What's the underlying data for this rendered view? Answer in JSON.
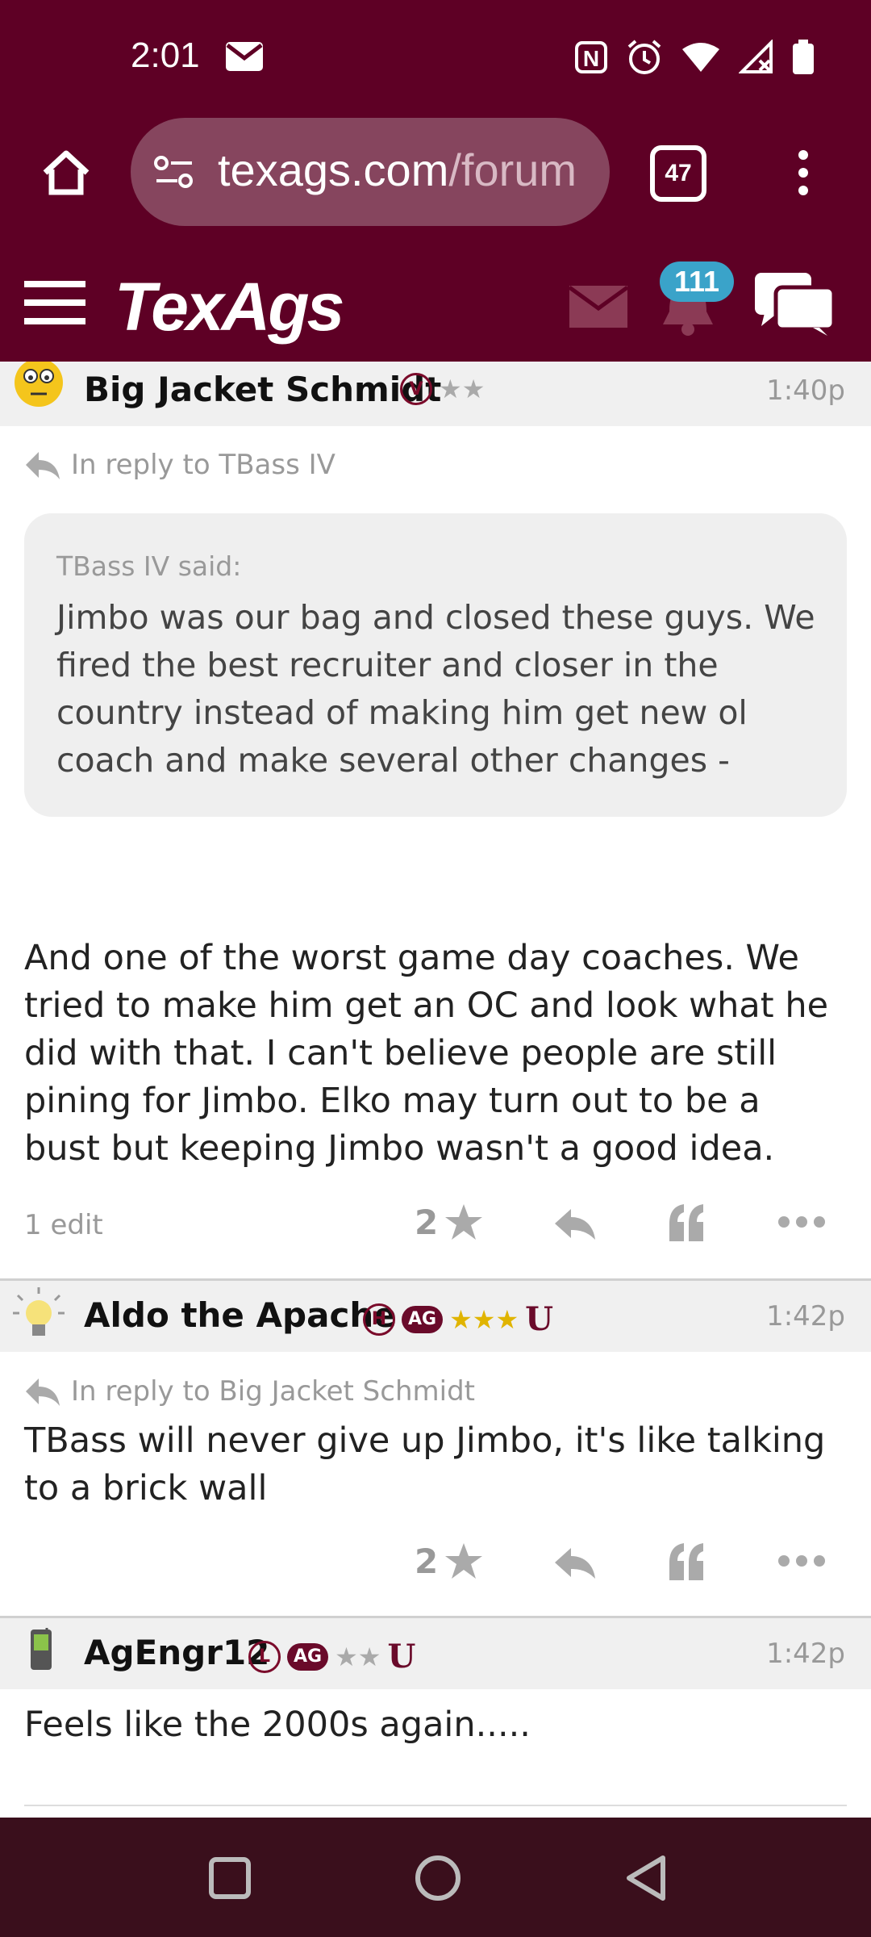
{
  "status_bar": {
    "time": "2:01"
  },
  "browser": {
    "url_main": "texags.com",
    "url_rest": "/forum",
    "tab_count": "47"
  },
  "site": {
    "logo": "TexAgs",
    "notifications_count": "111"
  },
  "posts": [
    {
      "username": "Big Jacket Schmidt",
      "badge": "V",
      "stars": "★★",
      "time": "1:40p",
      "reply_to": "In reply to TBass IV",
      "quote_author": "TBass IV said:",
      "quote_text": "Jimbo was our bag and closed these guys. We fired the best recruiter and closer in the country instead of making him get new ol coach and make several other changes -",
      "text": "And one of the worst game day coaches. We tried to make him get an OC and look what he did with that. I can't believe people are still pining for Jimbo. Elko may turn out to be a bust but keeping Jimbo wasn't a good idea.",
      "edit_note": "1 edit",
      "star_count": "2"
    },
    {
      "username": "Aldo the Apache",
      "badge": "H",
      "ag_badge": "AG",
      "stars": "★★★",
      "time": "1:42p",
      "reply_to": "In reply to Big Jacket Schmidt",
      "text": "TBass will never give up Jimbo, it's like talking to a brick wall",
      "star_count": "2"
    },
    {
      "username": "AgEngr12",
      "badge": "L",
      "ag_badge": "AG",
      "stars": "★★",
      "time": "1:42p",
      "text": "Feels like the 2000s again....."
    }
  ],
  "icons": {
    "home": "home-icon",
    "site_settings": "site-settings-icon",
    "menu": "kebab-menu-icon",
    "hamburger": "hamburger-icon",
    "mail": "mail-icon",
    "bell": "bell-icon",
    "chat": "chat-icon",
    "reply": "reply-icon",
    "quote": "quote-icon",
    "more": "more-icon",
    "star": "star-icon"
  },
  "colors": {
    "brand_maroon": "#5e0025",
    "badge_blue": "#3aa3c9",
    "nav_bar": "#3a0f1c"
  }
}
